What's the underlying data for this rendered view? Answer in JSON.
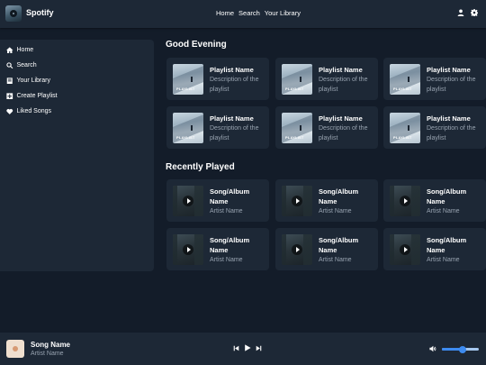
{
  "app": {
    "name": "Spotify"
  },
  "topnav": {
    "items": [
      "Home",
      "Search",
      "Your Library"
    ]
  },
  "sidebar": {
    "items": [
      {
        "label": "Home",
        "icon": "home-icon"
      },
      {
        "label": "Search",
        "icon": "search-icon"
      },
      {
        "label": "Your Library",
        "icon": "library-icon"
      },
      {
        "label": "Create Playlist",
        "icon": "plus-square-icon"
      },
      {
        "label": "Liked Songs",
        "icon": "heart-icon"
      }
    ]
  },
  "main": {
    "greeting": "Good Evening",
    "playlists": [
      {
        "title": "Playlist Name",
        "subtitle": "Description of the playlist",
        "art_label": "PLAYLIST"
      },
      {
        "title": "Playlist Name",
        "subtitle": "Description of the playlist",
        "art_label": "PLAYLIST"
      },
      {
        "title": "Playlist Name",
        "subtitle": "Description of the playlist",
        "art_label": "PLAYLIST"
      },
      {
        "title": "Playlist Name",
        "subtitle": "Description of the playlist",
        "art_label": "PLAYLIST"
      },
      {
        "title": "Playlist Name",
        "subtitle": "Description of the playlist",
        "art_label": "PLAYLIST"
      },
      {
        "title": "Playlist Name",
        "subtitle": "Description of the playlist",
        "art_label": "PLAYLIST"
      }
    ],
    "recent_title": "Recently Played",
    "recent": [
      {
        "title": "Song/Album Name",
        "subtitle": "Artist Name"
      },
      {
        "title": "Song/Album Name",
        "subtitle": "Artist Name"
      },
      {
        "title": "Song/Album Name",
        "subtitle": "Artist Name"
      },
      {
        "title": "Song/Album Name",
        "subtitle": "Artist Name"
      },
      {
        "title": "Song/Album Name",
        "subtitle": "Artist Name"
      },
      {
        "title": "Song/Album Name",
        "subtitle": "Artist Name"
      }
    ]
  },
  "player": {
    "song": "Song Name",
    "artist": "Artist Name",
    "volume": 0.55
  },
  "colors": {
    "background": "#131c29",
    "panel": "#1d2836",
    "muted_text": "#98a3b0",
    "accent": "#3d8bf0"
  }
}
